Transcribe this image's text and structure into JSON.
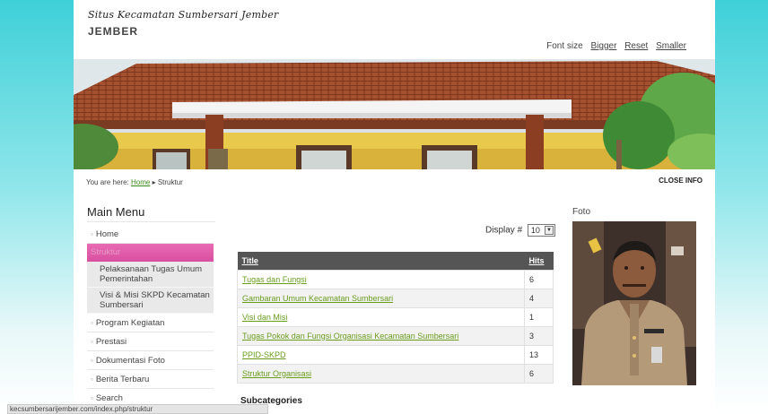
{
  "header": {
    "script_title": "Situs Kecamatan Sumbersari Jember",
    "site_name": "JEMBER",
    "font_size": {
      "label": "Font size",
      "bigger": "Bigger",
      "reset": "Reset",
      "smaller": "Smaller"
    }
  },
  "breadcrumb": {
    "prefix": "You are here:",
    "home": "Home",
    "separator": "▸",
    "current": "Struktur"
  },
  "close_info": "CLOSE INFO",
  "main_menu": {
    "title": "Main Menu",
    "items": [
      {
        "label": "Home"
      },
      {
        "label": "Struktur"
      },
      {
        "label": "Pelaksanaan Tugas Umum Pemerintahan"
      },
      {
        "label": "Visi & Misi SKPD Kecamatan Sumbersari"
      },
      {
        "label": "Program Kegiatan"
      },
      {
        "label": "Prestasi"
      },
      {
        "label": "Dokumentasi Foto"
      },
      {
        "label": "Berita Terbaru"
      },
      {
        "label": "Search"
      }
    ]
  },
  "display": {
    "label": "Display #",
    "value": "10"
  },
  "table": {
    "headers": {
      "title": "Title",
      "hits": "Hits"
    },
    "rows": [
      {
        "title": "Tugas dan Fungsi",
        "hits": "6"
      },
      {
        "title": "Gambaran Umum Kecamatan Sumbersari",
        "hits": "4"
      },
      {
        "title": "Visi dan Misi",
        "hits": "1"
      },
      {
        "title": "Tugas Pokok dan Fungsi Organisasi Kecamatan Sumbersari",
        "hits": "3"
      },
      {
        "title": "PPID-SKPD",
        "hits": "13"
      },
      {
        "title": "Struktur Organisasi",
        "hits": "6"
      }
    ]
  },
  "subcategories": "Subcategories",
  "foto": {
    "title": "Foto"
  },
  "status_bar": "kecsumbersarijember.com/index.php/struktur",
  "colors": {
    "accent": "#d94fa0",
    "link": "#6a9c1e",
    "table_header": "#555555",
    "background": "#3fd0d8"
  }
}
